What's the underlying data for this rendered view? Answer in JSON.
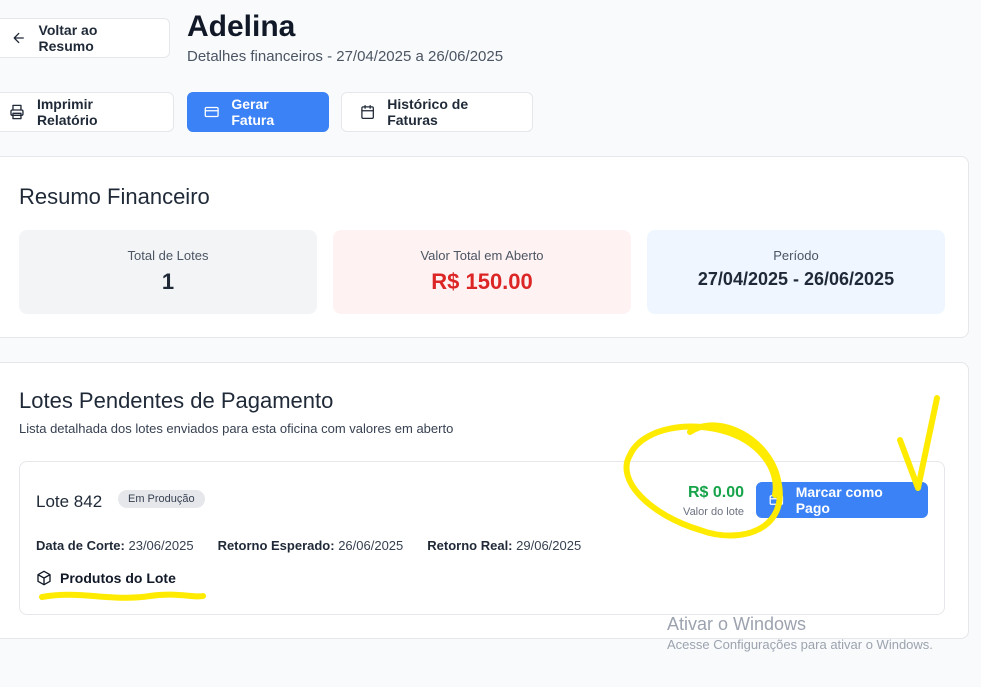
{
  "header": {
    "back_label": "Voltar ao Resumo",
    "title": "Adelina",
    "subtitle": "Detalhes financeiros - 27/04/2025 a 26/06/2025"
  },
  "toolbar": {
    "print_label": "Imprimir Relatório",
    "invoice_label": "Gerar Fatura",
    "history_label": "Histórico de Faturas"
  },
  "summary": {
    "title": "Resumo Financeiro",
    "stats": [
      {
        "label": "Total de Lotes",
        "value": "1"
      },
      {
        "label": "Valor Total em Aberto",
        "value": "R$ 150.00"
      },
      {
        "label": "Período",
        "value": "27/04/2025 - 26/06/2025"
      }
    ]
  },
  "pending": {
    "title": "Lotes Pendentes de Pagamento",
    "subtitle": "Lista detalhada dos lotes enviados para esta oficina com valores em aberto",
    "lote": {
      "name": "Lote 842",
      "badge": "Em Produção",
      "cut_label": "Data de Corte:",
      "cut_value": "23/06/2025",
      "expected_label": "Retorno Esperado:",
      "expected_value": "26/06/2025",
      "real_label": "Retorno Real:",
      "real_value": "29/06/2025",
      "products_label": "Produtos do Lote",
      "amount": "R$ 0.00",
      "amount_caption": "Valor do lote",
      "pay_label": "Marcar como Pago"
    }
  },
  "watermark": {
    "line1": "Ativar o Windows",
    "line2": "Acesse Configurações para ativar o Windows."
  },
  "colors": {
    "primary": "#3b82f6",
    "danger": "#dc2626",
    "success": "#16a34a",
    "annotation": "#ffeb00"
  },
  "icons": [
    "arrow-left-icon",
    "printer-icon",
    "credit-card-icon",
    "calendar-icon",
    "package-icon"
  ]
}
